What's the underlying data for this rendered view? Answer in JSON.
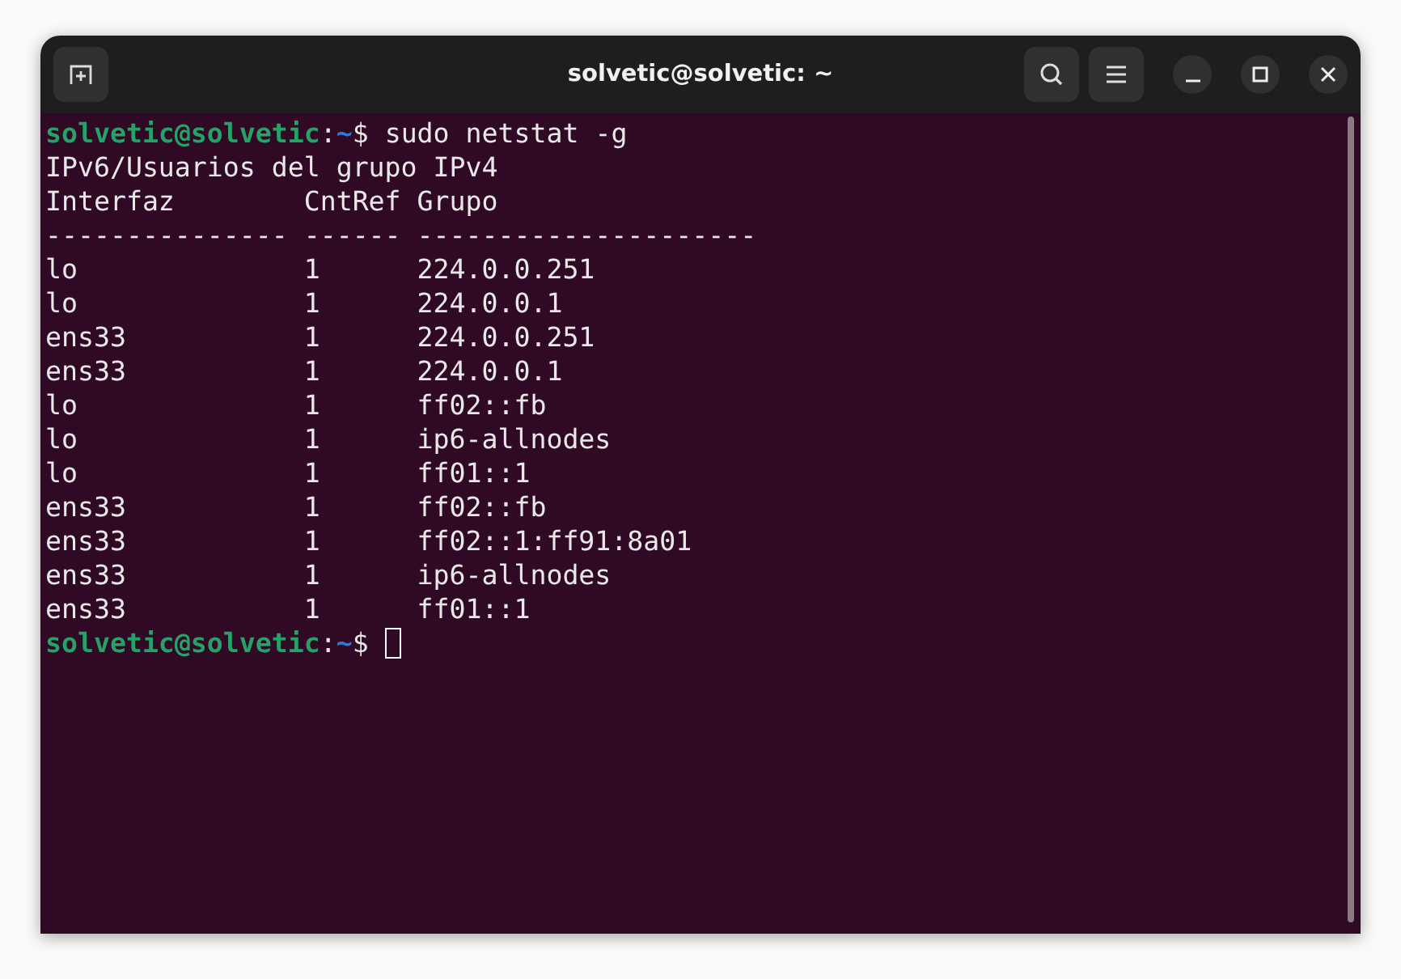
{
  "window": {
    "title": "solvetic@solvetic: ~"
  },
  "terminal": {
    "lines": [
      {
        "kind": "prompt",
        "user_host": "solvetic@solvetic",
        "separator": ":",
        "path": "~",
        "symbol": "$",
        "command": "sudo netstat -g"
      },
      {
        "kind": "output",
        "text": "IPv6/Usuarios del grupo IPv4"
      },
      {
        "kind": "output",
        "text": "Interfaz        CntRef Grupo"
      },
      {
        "kind": "output",
        "text": "--------------- ------ ---------------------"
      },
      {
        "kind": "output",
        "text": "lo              1      224.0.0.251"
      },
      {
        "kind": "output",
        "text": "lo              1      224.0.0.1"
      },
      {
        "kind": "output",
        "text": "ens33           1      224.0.0.251"
      },
      {
        "kind": "output",
        "text": "ens33           1      224.0.0.1"
      },
      {
        "kind": "output",
        "text": "lo              1      ff02::fb"
      },
      {
        "kind": "output",
        "text": "lo              1      ip6-allnodes"
      },
      {
        "kind": "output",
        "text": "lo              1      ff01::1"
      },
      {
        "kind": "output",
        "text": "ens33           1      ff02::fb"
      },
      {
        "kind": "output",
        "text": "ens33           1      ff02::1:ff91:8a01"
      },
      {
        "kind": "output",
        "text": "ens33           1      ip6-allnodes"
      },
      {
        "kind": "output",
        "text": "ens33           1      ff01::1"
      },
      {
        "kind": "prompt",
        "user_host": "solvetic@solvetic",
        "separator": ":",
        "path": "~",
        "symbol": "$",
        "cursor": true
      }
    ]
  }
}
